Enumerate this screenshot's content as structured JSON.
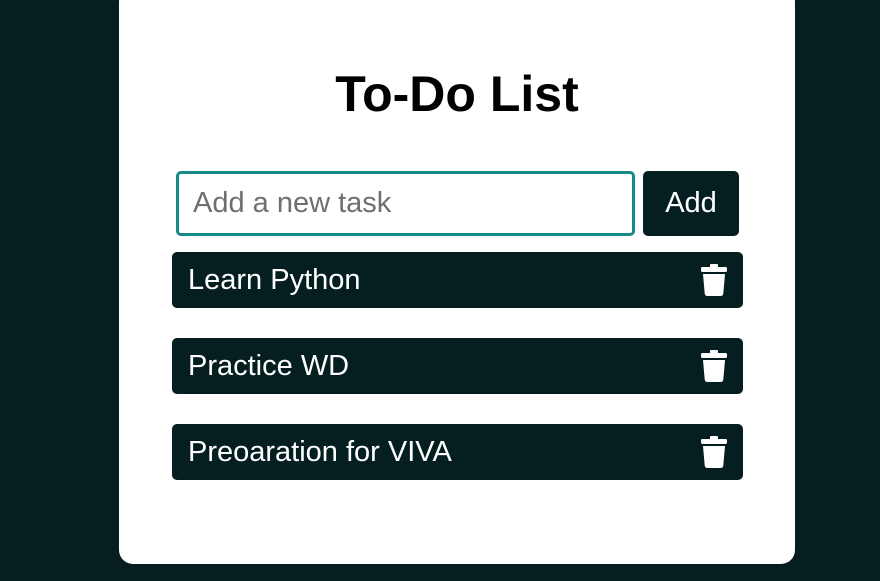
{
  "app": {
    "title": "To-Do List"
  },
  "new_task": {
    "placeholder": "Add a new task",
    "value": "",
    "add_label": "Add"
  },
  "tasks": [
    {
      "label": "Learn Python",
      "icon": "trash-icon"
    },
    {
      "label": "Practice WD",
      "icon": "trash-icon"
    },
    {
      "label": "Preoaration for VIVA",
      "icon": "trash-icon"
    }
  ],
  "colors": {
    "background": "#051f20",
    "card": "#ffffff",
    "input_border": "#178a87",
    "task_bg": "#051f20",
    "task_text": "#ffffff"
  }
}
